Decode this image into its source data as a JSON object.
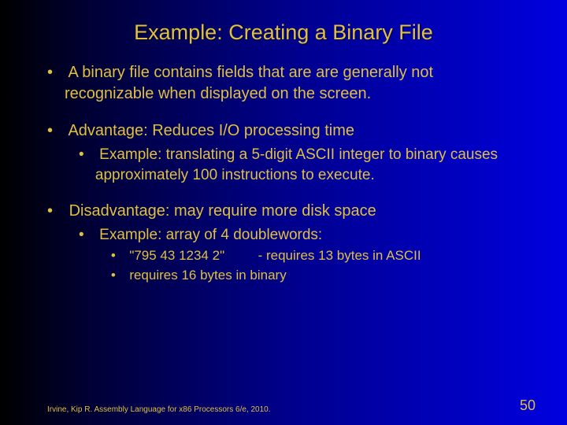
{
  "title": "Example: Creating a Binary File",
  "bullets": {
    "b1_pre": "A ",
    "b1_em": "binary file",
    "b1_post": " contains fields that are are generally not recognizable when displayed on the screen.",
    "b2": "Advantage: Reduces I/O processing time",
    "b2a": "Example: translating a 5-digit ASCII integer to binary causes approximately 100 instructions to execute.",
    "b3": "Disadvantage: may require more disk space",
    "b3a": "Example: array of 4 doublewords:",
    "b3a1": "\"795 43 1234 2\"         - requires 13 bytes in ASCII",
    "b3a2": "requires 16 bytes in binary"
  },
  "footer": "Irvine, Kip R. Assembly Language for x86 Processors 6/e, 2010.",
  "page": "50"
}
